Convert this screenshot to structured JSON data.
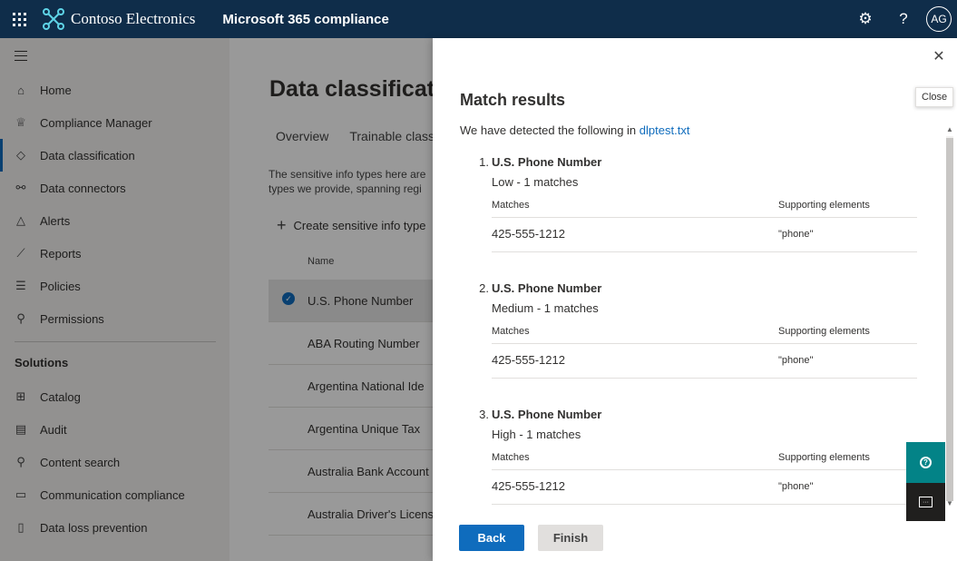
{
  "topbar": {
    "brand": "Contoso Electronics",
    "app_title": "Microsoft 365 compliance",
    "avatar_initials": "AG"
  },
  "nav": {
    "items": [
      {
        "label": "Home",
        "icon": "home-icon"
      },
      {
        "label": "Compliance Manager",
        "icon": "trophy-icon"
      },
      {
        "label": "Data classification",
        "icon": "tag-icon"
      },
      {
        "label": "Data connectors",
        "icon": "connector-icon"
      },
      {
        "label": "Alerts",
        "icon": "warning-icon"
      },
      {
        "label": "Reports",
        "icon": "chart-icon"
      },
      {
        "label": "Policies",
        "icon": "sliders-icon"
      },
      {
        "label": "Permissions",
        "icon": "key-icon"
      }
    ],
    "section_label": "Solutions",
    "solutions": [
      {
        "label": "Catalog",
        "icon": "grid-icon"
      },
      {
        "label": "Audit",
        "icon": "document-icon"
      },
      {
        "label": "Content search",
        "icon": "search-icon"
      },
      {
        "label": "Communication compliance",
        "icon": "chat-icon"
      },
      {
        "label": "Data loss prevention",
        "icon": "shield-icon"
      }
    ]
  },
  "main": {
    "title": "Data classificat",
    "tabs": [
      "Overview",
      "Trainable class"
    ],
    "description": "The sensitive info types here are types we provide, spanning regi",
    "description_lines": [
      "The sensitive info types here are",
      "types we provide, spanning regi"
    ],
    "create_label": "Create sensitive info type",
    "col_name": "Name",
    "rows": [
      "U.S. Phone Number",
      "ABA Routing Number",
      "Argentina National Ide",
      "Argentina Unique Tax",
      "Australia Bank Account",
      "Australia Driver's Licens"
    ]
  },
  "panel": {
    "title": "Match results",
    "intro": "We have detected the following in",
    "filename": "dlptest.txt",
    "tooltip": "Close",
    "col_matches": "Matches",
    "col_supporting": "Supporting elements",
    "results": [
      {
        "num": "1.",
        "title": "U.S. Phone Number",
        "level": "Low - 1 matches",
        "match": "425-555-1212",
        "supporting": "\"phone\""
      },
      {
        "num": "2.",
        "title": "U.S. Phone Number",
        "level": "Medium - 1 matches",
        "match": "425-555-1212",
        "supporting": "\"phone\""
      },
      {
        "num": "3.",
        "title": "U.S. Phone Number",
        "level": "High - 1 matches",
        "match": "425-555-1212",
        "supporting": "\"phone\""
      }
    ],
    "back_label": "Back",
    "finish_label": "Finish"
  },
  "colors": {
    "topbar": "#0f2d4a",
    "primary": "#0f6cbd",
    "teal": "#038387"
  }
}
